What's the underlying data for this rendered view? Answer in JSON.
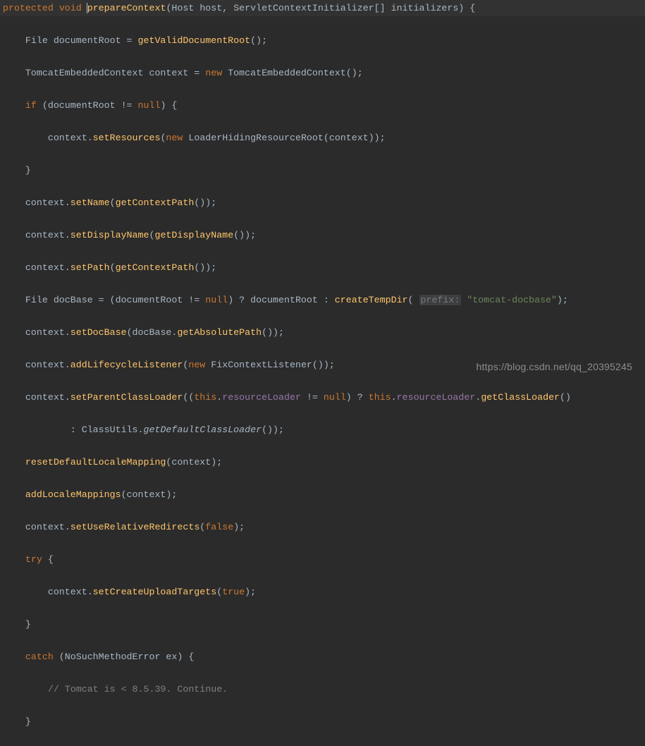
{
  "colors": {
    "background": "#2b2b2b",
    "text": "#a9b7c6",
    "keyword": "#cc7832",
    "method": "#ffc66d",
    "string": "#6a8759",
    "comment": "#808080",
    "field": "#9876aa",
    "hint_bg": "#3c3f41",
    "line_hi": "#323232"
  },
  "signature": {
    "modifier1": "protected",
    "modifier2": "void",
    "name": "prepareContext",
    "params": "(Host host, ServletContextInitializer[] initializers) {"
  },
  "l2": {
    "a": "    File documentRoot = ",
    "m": "getValidDocumentRoot",
    "b": "();"
  },
  "l3": {
    "a": "    TomcatEmbeddedContext context = ",
    "kw": "new",
    "b": " TomcatEmbeddedContext();"
  },
  "l4": {
    "kw": "if",
    "b": " (documentRoot != ",
    "kw2": "null",
    "c": ") {"
  },
  "l5": {
    "a": "        context.",
    "m": "setResources",
    "b": "(",
    "kw": "new",
    "c": " LoaderHidingResourceRoot(context));"
  },
  "l6": "    }",
  "l7": {
    "a": "    context.",
    "m": "setName",
    "b": "(",
    "m2": "getContextPath",
    "c": "());"
  },
  "l8": {
    "a": "    context.",
    "m": "setDisplayName",
    "b": "(",
    "m2": "getDisplayName",
    "c": "());"
  },
  "l9": {
    "a": "    context.",
    "m": "setPath",
    "b": "(",
    "m2": "getContextPath",
    "c": "());"
  },
  "l10": {
    "a": "    File docBase = (documentRoot != ",
    "kw": "null",
    "b": ") ? documentRoot : ",
    "m": "createTempDir",
    "c": "( ",
    "hint": "prefix:",
    "d": " ",
    "str": "\"tomcat-docbase\"",
    "e": ");"
  },
  "l11": {
    "a": "    context.",
    "m": "setDocBase",
    "b": "(docBase.",
    "m2": "getAbsolutePath",
    "c": "());"
  },
  "l12": {
    "a": "    context.",
    "m": "addLifecycleListener",
    "b": "(",
    "kw": "new",
    "c": " FixContextListener());"
  },
  "l13": {
    "a": "    context.",
    "m": "setParentClassLoader",
    "b": "((",
    "kw": "this",
    "c": ".",
    "f": "resourceLoader",
    "d": " != ",
    "kw2": "null",
    "e": ") ? ",
    "kw3": "this",
    "g": ".",
    "f2": "resourceLoader",
    "h": ".",
    "m2": "getClassLoader",
    "i": "()"
  },
  "l14": {
    "a": "            : ClassUtils.",
    "it": "getDefaultClassLoader",
    "b": "());"
  },
  "l15": {
    "a": "    ",
    "m": "resetDefaultLocaleMapping",
    "b": "(context);"
  },
  "l16": {
    "a": "    ",
    "m": "addLocaleMappings",
    "b": "(context);"
  },
  "l17": {
    "a": "    context.",
    "m": "setUseRelativeRedirects",
    "b": "(",
    "kw": "false",
    "c": ");"
  },
  "l18": {
    "kw": "try",
    "b": " {"
  },
  "l19": {
    "a": "        context.",
    "m": "setCreateUploadTargets",
    "b": "(",
    "kw": "true",
    "c": ");"
  },
  "l20": "    }",
  "l21": {
    "kw": "catch",
    "b": " (NoSuchMethodError ex) {"
  },
  "l22": "        // Tomcat is < 8.5.39. Continue.",
  "l23": "    }",
  "watermark": "https://blog.csdn.net/qq_20395245"
}
